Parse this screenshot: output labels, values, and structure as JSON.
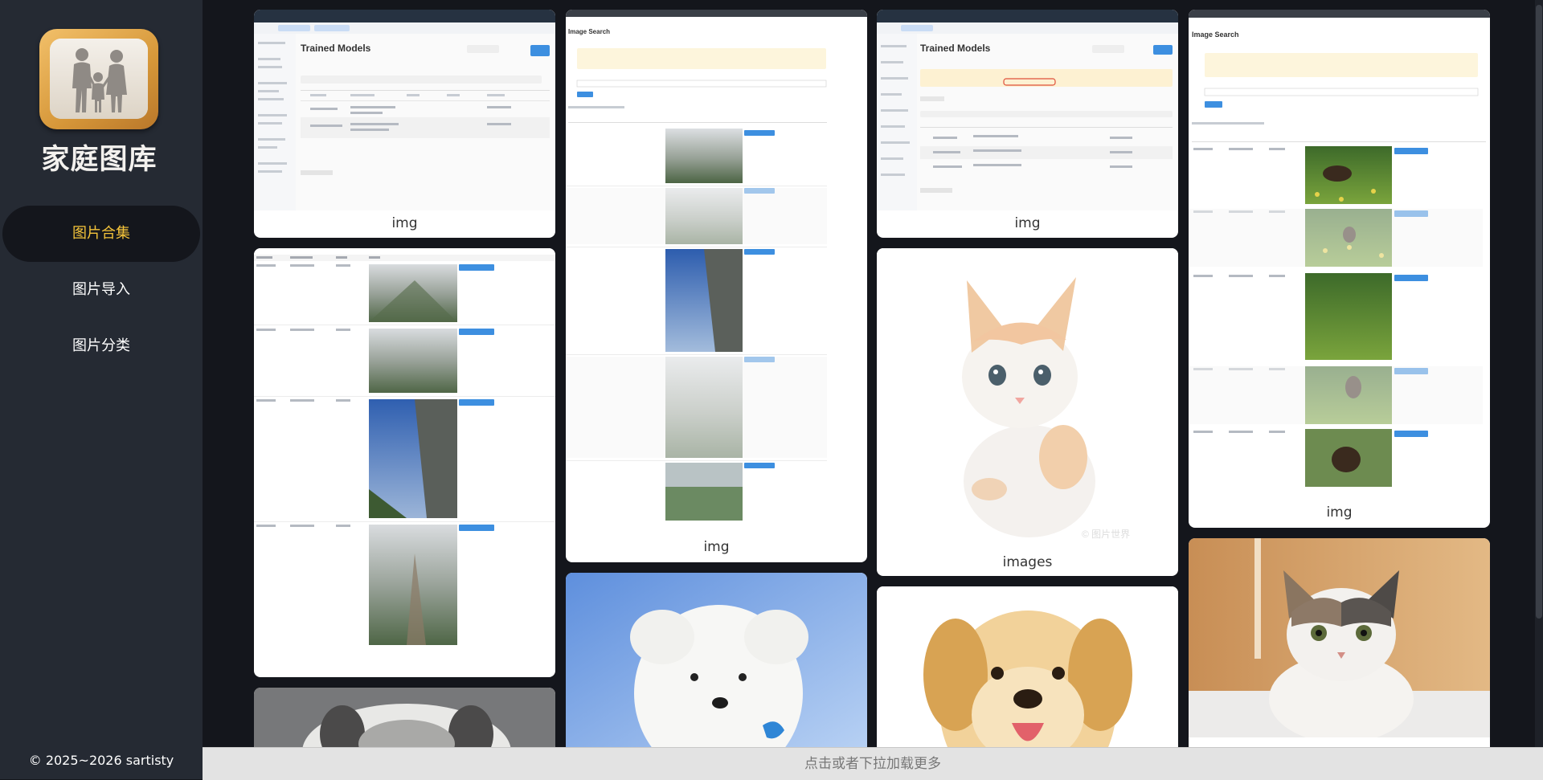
{
  "app": {
    "logo_text": "家庭图库",
    "logo_icon": "family-photo-icon"
  },
  "nav": {
    "items": [
      {
        "label": "图片合集",
        "active": true
      },
      {
        "label": "图片导入",
        "active": false
      },
      {
        "label": "图片分类",
        "active": false
      }
    ]
  },
  "footer": {
    "copyright": "© 2025~2026 sartisty"
  },
  "gallery": {
    "cards": [
      {
        "caption": "img",
        "content": "screenshot-trained-models"
      },
      {
        "caption": "img",
        "content": "screenshot-image-search-results"
      },
      {
        "caption": "",
        "content": "kitten-photo"
      },
      {
        "caption": "img",
        "content": "screenshot-image-search"
      },
      {
        "caption": "",
        "content": "white-puppy-photo"
      },
      {
        "caption": "img",
        "content": "screenshot-trained-models-warning"
      },
      {
        "caption": "images",
        "content": "kitten-photo"
      },
      {
        "caption": "",
        "content": "golden-puppy-photo"
      },
      {
        "caption": "img",
        "content": "screenshot-image-search-dogs"
      },
      {
        "caption": "",
        "content": "tabby-cat-photo"
      }
    ]
  },
  "load_more": {
    "label": "点击或者下拉加载更多"
  },
  "colors": {
    "sidebar_bg": "#252a33",
    "page_bg": "#14161c",
    "active_text": "#f5c43a",
    "accent_button": "#3d8fe0"
  }
}
